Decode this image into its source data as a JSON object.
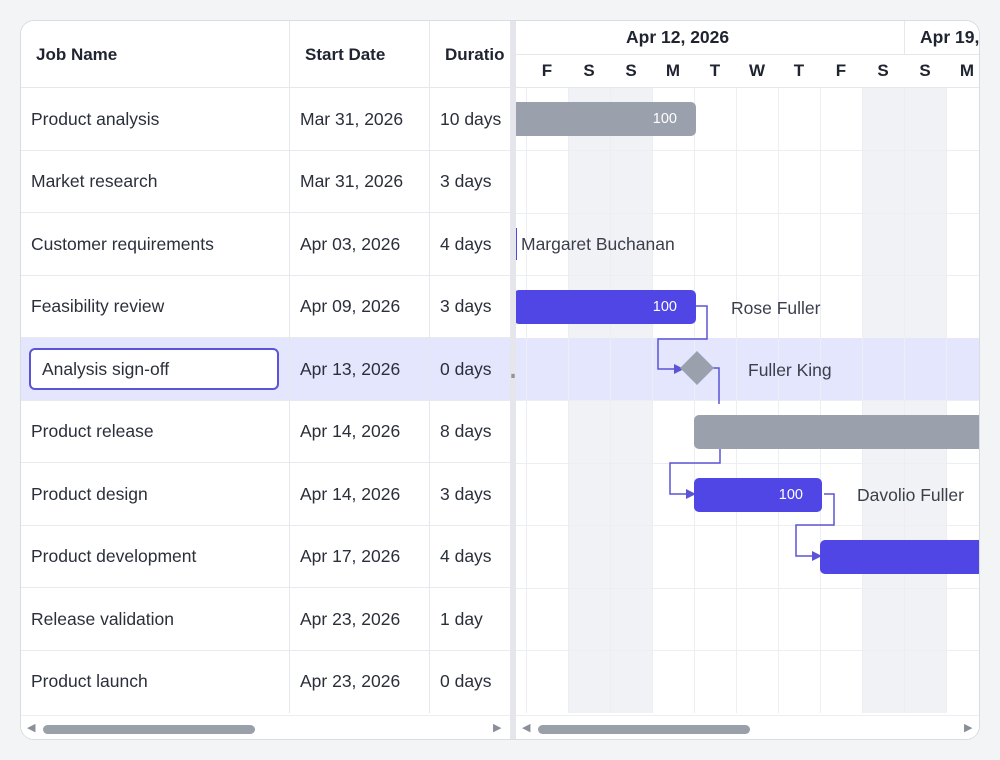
{
  "grid": {
    "columns": [
      "Job Name",
      "Start Date",
      "Duratio"
    ],
    "rows": [
      {
        "name": "Product analysis",
        "start": "Mar 31, 2026",
        "duration": "10 days"
      },
      {
        "name": "Market research",
        "start": "Mar 31, 2026",
        "duration": "3 days"
      },
      {
        "name": "Customer requirements",
        "start": "Apr 03, 2026",
        "duration": "4 days"
      },
      {
        "name": "Feasibility review",
        "start": "Apr 09, 2026",
        "duration": "3 days"
      },
      {
        "name": "Analysis sign-off",
        "start": "Apr 13, 2026",
        "duration": "0 days"
      },
      {
        "name": "Product release",
        "start": "Apr 14, 2026",
        "duration": "8 days"
      },
      {
        "name": "Product design",
        "start": "Apr 14, 2026",
        "duration": "3 days"
      },
      {
        "name": "Product development",
        "start": "Apr 17, 2026",
        "duration": "4 days"
      },
      {
        "name": "Release validation",
        "start": "Apr 23, 2026",
        "duration": "1 day"
      },
      {
        "name": "Product launch",
        "start": "Apr 23, 2026",
        "duration": "0 days"
      }
    ],
    "selected_row": 4,
    "edit_value": "Analysis sign-off"
  },
  "timeline": {
    "weeks": [
      "Apr 12, 2026",
      "Apr 19,"
    ],
    "days": [
      "F",
      "F",
      "S",
      "S",
      "M",
      "T",
      "W",
      "T",
      "F",
      "S",
      "S",
      "M"
    ]
  },
  "taskbars": {
    "product_analysis_progress": "100",
    "feasibility_progress": "100",
    "product_design_progress": "100",
    "customer_requirements_resource": "Margaret Buchanan",
    "feasibility_resource": "Rose Fuller",
    "signoff_resource": "Fuller King",
    "design_resource": "Davolio Fuller"
  },
  "colors": {
    "accent": "#4f46e5",
    "parent_bar": "#9aa1ad",
    "selection": "#e3e6fd"
  },
  "icons": {
    "scroll_left": "◀",
    "scroll_right": "▶",
    "splitter_grip": "⏸"
  }
}
